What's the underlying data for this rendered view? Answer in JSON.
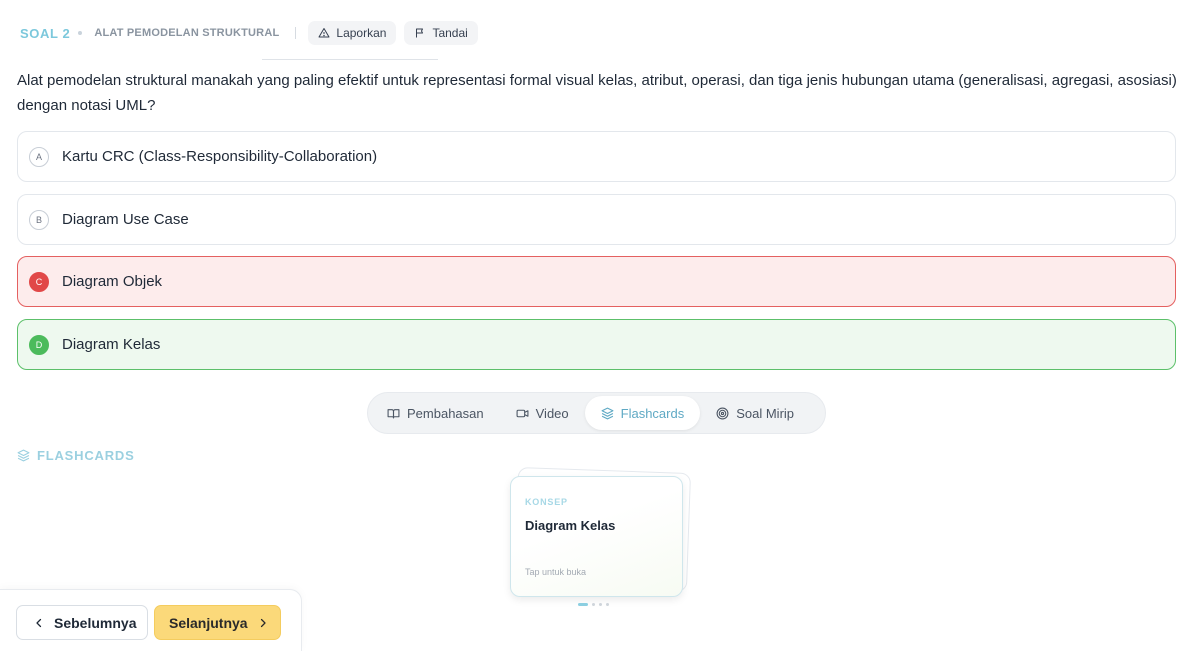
{
  "header": {
    "question_number": "SOAL 2",
    "topic": "ALAT PEMODELAN STRUKTURAL",
    "report_label": "Laporkan",
    "flag_label": "Tandai"
  },
  "question": {
    "text": "Alat pemodelan struktural manakah yang paling efektif untuk representasi formal visual kelas, atribut, operasi, dan tiga jenis hubungan utama (generalisasi, agregasi, asosiasi) dengan notasi UML?"
  },
  "options": [
    {
      "letter": "A",
      "text": "Kartu CRC (Class-Responsibility-Collaboration)",
      "state": "neutral"
    },
    {
      "letter": "B",
      "text": "Diagram Use Case",
      "state": "neutral"
    },
    {
      "letter": "C",
      "text": "Diagram Objek",
      "state": "wrong"
    },
    {
      "letter": "D",
      "text": "Diagram Kelas",
      "state": "correct"
    }
  ],
  "tabs": [
    {
      "label": "Pembahasan",
      "icon": "book-open-icon",
      "active": false
    },
    {
      "label": "Video",
      "icon": "video-icon",
      "active": false
    },
    {
      "label": "Flashcards",
      "icon": "layers-icon",
      "active": true
    },
    {
      "label": "Soal Mirip",
      "icon": "target-icon",
      "active": false
    }
  ],
  "flashcards": {
    "section_title": "FLASHCARDS",
    "card": {
      "kind": "KONSEP",
      "term": "Diagram Kelas",
      "hint": "Tap untuk buka"
    },
    "pagination": {
      "current": 1,
      "total": 4
    }
  },
  "footer": {
    "prev_label": "Sebelumnya",
    "next_label": "Selanjutnya"
  },
  "colors": {
    "accent": "#7cc8dc",
    "wrong": "#e14848",
    "correct": "#4cbb5c",
    "next_button": "#fbd97a"
  }
}
